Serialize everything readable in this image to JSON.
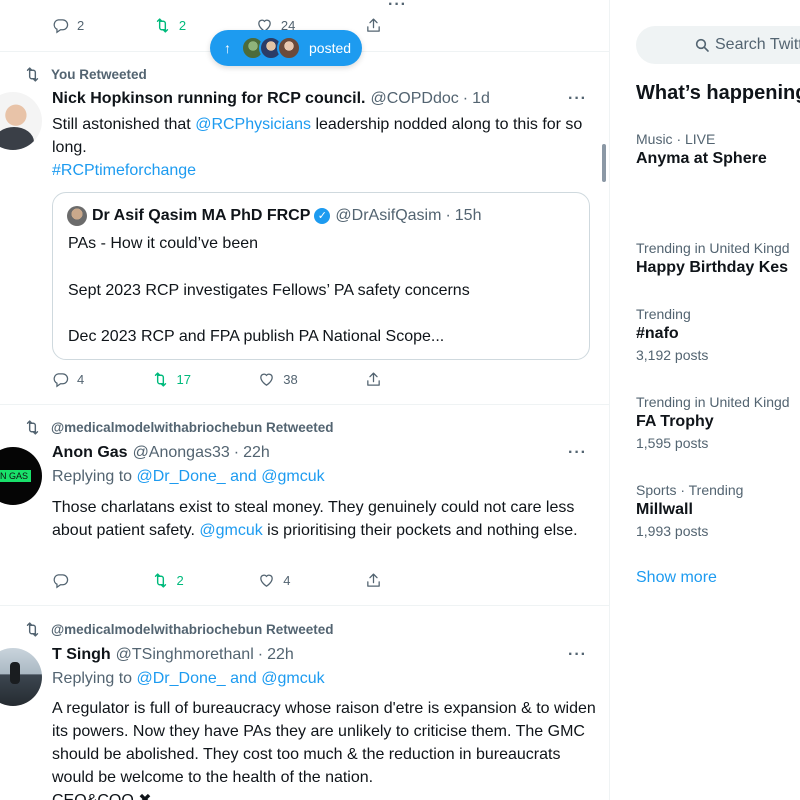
{
  "top_actions": {
    "reply": "2",
    "retweet": "2",
    "like": "24"
  },
  "new_posts_pill": {
    "label": "posted"
  },
  "tweets": [
    {
      "context": "You Retweeted",
      "name": "Nick Hopkinson running for RCP council.",
      "handle": "@COPDdoc",
      "sep": "·",
      "time": "1d",
      "more": "···",
      "text_1": "Still astonished that ",
      "mention": "@RCPhysicians",
      "text_2": " leadership nodded along to this for so long.",
      "hashtag": "#RCPtimeforchange",
      "quote": {
        "name": "Dr Asif Qasim MA PhD FRCP",
        "handle": "@DrAsifQasim",
        "time": "15h",
        "line1": "PAs - How it could’ve been",
        "line2": "Sept 2023 RCP investigates Fellows’ PA safety concerns",
        "line3": "Dec 2023 RCP and FPA publish PA National Scope..."
      },
      "reply_count": "4",
      "retweet_count": "17",
      "like_count": "38"
    },
    {
      "context": "@medicalmodelwithabriochebun Retweeted",
      "name": "Anon Gas",
      "handle": "@Anongas33",
      "sep": "·",
      "time": "22h",
      "more": "···",
      "avatar_text": "ON GAS",
      "replying_prefix": "Replying to ",
      "replying_to": "@Dr_Done_ and @gmcuk",
      "text_1": "Those charlatans exist to steal money. They genuinely could not care less about patient safety. ",
      "mention": "@gmcuk",
      "text_2": " is prioritising their pockets and nothing else.",
      "reply_count": "",
      "retweet_count": "2",
      "like_count": "4"
    },
    {
      "context": "@medicalmodelwithabriochebun Retweeted",
      "name": "T Singh",
      "handle": "@TSinghmorethanl",
      "sep": "·",
      "time": "22h",
      "more": "···",
      "replying_prefix": "Replying to ",
      "replying_to": "@Dr_Done_ and @gmcuk",
      "text": "A regulator is full of bureaucracy whose raison d'etre is expansion & to widen its powers. Now they have PAs they are unlikely to criticise them. The GMC should be abolished. They cost too much & the reduction in bureaucrats would be welcome to the health of the nation.",
      "text_cut": "CEO&COO ✖"
    }
  ],
  "sidebar": {
    "search_placeholder": "Search Twitt",
    "title": "What’s happening",
    "trends": [
      {
        "context": "Music · LIVE",
        "name": "Anyma at Sphere",
        "posts": ""
      },
      {
        "context": "Trending in United Kingd",
        "name": "Happy Birthday Kes",
        "posts": ""
      },
      {
        "context": "Trending",
        "name": "#nafo",
        "posts": "3,192 posts"
      },
      {
        "context": "Trending in United Kingd",
        "name": "FA Trophy",
        "posts": "1,595 posts"
      },
      {
        "context": "Sports · Trending",
        "name": "Millwall",
        "posts": "1,993 posts"
      }
    ],
    "show_more": "Show more"
  },
  "colors": {
    "accent": "#1d9bf0",
    "retweet": "#00ba7c",
    "secondary": "#536471"
  }
}
